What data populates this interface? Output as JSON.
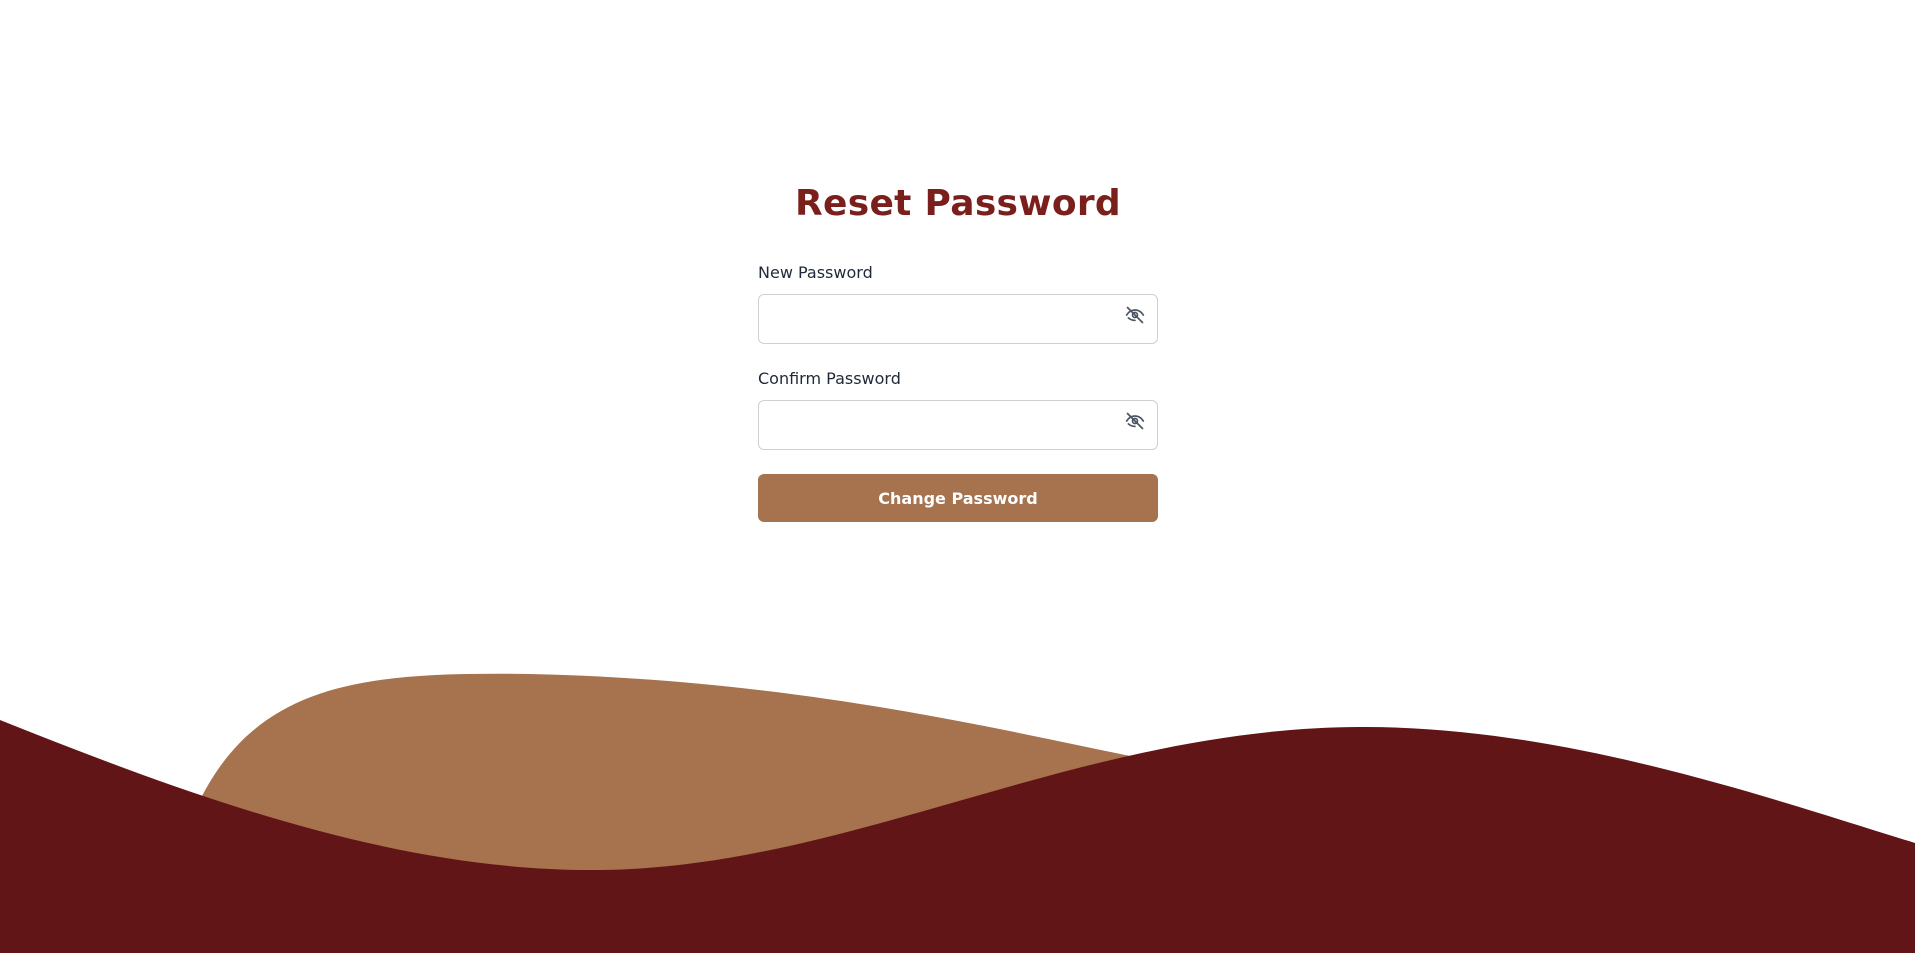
{
  "page": {
    "title": "Reset Password"
  },
  "form": {
    "new_password": {
      "label": "New Password",
      "value": "",
      "placeholder": "",
      "toggle_icon": "eye-off-icon"
    },
    "confirm_password": {
      "label": "Confirm Password",
      "value": "",
      "placeholder": "",
      "toggle_icon": "eye-off-icon"
    },
    "submit_label": "Change Password"
  },
  "colors": {
    "title": "#7b1f1d",
    "button": "#a6734e",
    "wave_light": "#a6734e",
    "wave_dark": "#611517",
    "label": "#1f2937",
    "input_border": "#cfcfd4"
  }
}
